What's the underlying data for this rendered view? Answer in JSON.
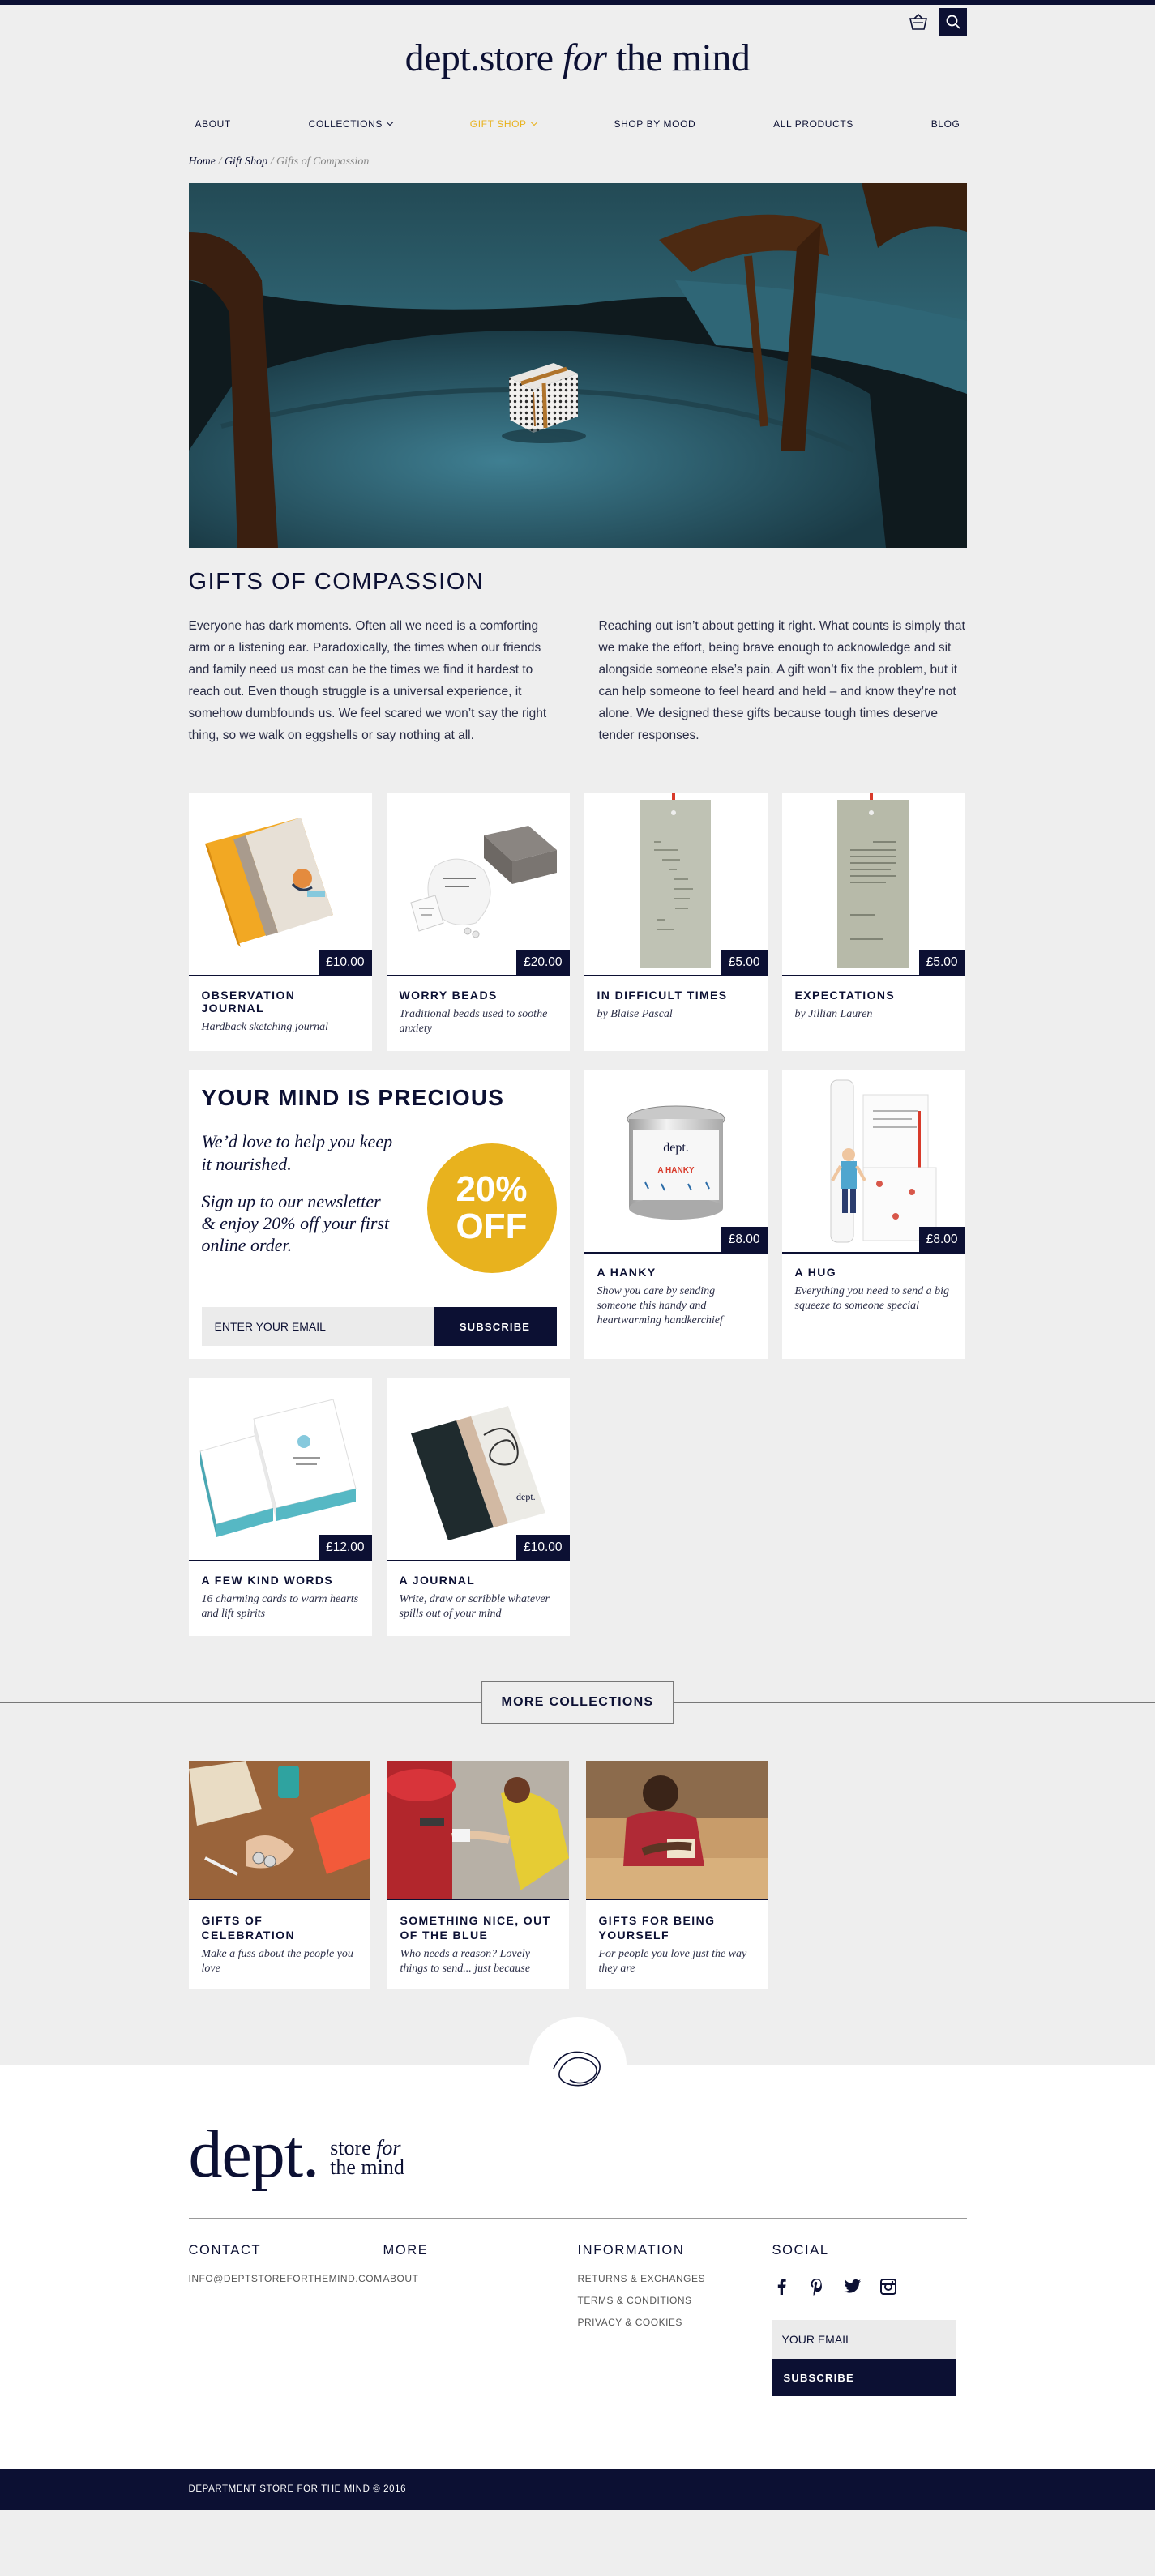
{
  "header": {
    "logo_left": "dept.store ",
    "logo_italic": "for",
    "logo_right": " the mind"
  },
  "nav": {
    "items": [
      "ABOUT",
      "COLLECTIONS",
      "GIFT SHOP",
      "SHOP BY MOOD",
      "ALL PRODUCTS",
      "BLOG"
    ],
    "active": "GIFT SHOP"
  },
  "breadcrumb": {
    "home": "Home",
    "shop": "Gift Shop",
    "current": "Gifts of Compassion",
    "separator": "/"
  },
  "page": {
    "title": "GIFTS OF COMPASSION",
    "intro_left": "Everyone has dark moments. Often all we need is a comforting arm or a listening ear. Paradoxically, the times when our friends and family need us most can be the times we find it hardest to reach out. Even though struggle is a universal experience, it somehow dumbfounds us. We feel scared we won’t say the right thing, so we walk on eggshells or say nothing at all.",
    "intro_right": "Reaching out isn’t about getting it right. What counts is simply that we make the effort, being brave enough to acknowledge and sit alongside someone else’s pain. A gift won’t fix the problem, but it can help someone to feel heard and held – and know they’re not alone. We designed these gifts because tough times deserve tender responses."
  },
  "products": [
    {
      "name": "OBSERVATION JOURNAL",
      "desc": "Hardback sketching journal",
      "price": "£10.00"
    },
    {
      "name": "WORRY BEADS",
      "desc": "Traditional beads used to soothe anxiety",
      "price": "£20.00"
    },
    {
      "name": "IN DIFFICULT TIMES",
      "desc": "by Blaise Pascal",
      "price": "£5.00"
    },
    {
      "name": "EXPECTATIONS",
      "desc": "by Jillian Lauren",
      "price": "£5.00"
    },
    {
      "name": "A HANKY",
      "desc": "Show you care by sending someone this handy and heartwarming handkerchief",
      "price": "£8.00",
      "tin_brand": "dept.",
      "tin_label": "A HANKY"
    },
    {
      "name": "A HUG",
      "desc": "Everything you need to send a big squeeze to someone special",
      "price": "£8.00"
    },
    {
      "name": "A FEW KIND WORDS",
      "desc": "16 charming cards to warm hearts and lift spirits",
      "price": "£12.00"
    },
    {
      "name": "A JOURNAL",
      "desc": "Write, draw or scribble whatever spills out of your mind",
      "price": "£10.00"
    }
  ],
  "promo": {
    "title": "YOUR MIND IS PRECIOUS",
    "line1": "We’d love to help you keep it nourished.",
    "line2": "Sign up to our newsletter & enjoy 20% off your first online order.",
    "badge_top": "20%",
    "badge_bottom": "OFF",
    "email_placeholder": "ENTER YOUR EMAIL",
    "subscribe": "SUBSCRIBE"
  },
  "more_collections": {
    "label": "MORE COLLECTIONS",
    "items": [
      {
        "name": "GIFTS OF CELEBRATION",
        "desc": "Make a fuss about the people you love"
      },
      {
        "name": "SOMETHING NICE, OUT OF THE BLUE",
        "desc": "Who needs a reason? Lovely things to send... just because"
      },
      {
        "name": "GIFTS FOR BEING YOURSELF",
        "desc": "For people you love just the way they are"
      }
    ]
  },
  "footer": {
    "logo_big": "dept.",
    "logo_small_1": "store ",
    "logo_small_italic": "for",
    "logo_small_2": "the mind",
    "contact_title": "CONTACT",
    "contact_email": "INFO@DEPTSTOREFORTHEMIND.COM",
    "more_title": "MORE",
    "more_links": [
      "ABOUT"
    ],
    "info_title": "INFORMATION",
    "info_links": [
      "RETURNS & EXCHANGES",
      "TERMS & CONDITIONS",
      "PRIVACY & COOKIES"
    ],
    "social_title": "SOCIAL",
    "social_icons": [
      "facebook-icon",
      "pinterest-icon",
      "twitter-icon",
      "instagram-icon"
    ],
    "email_placeholder": "YOUR EMAIL",
    "subscribe": "SUBSCRIBE",
    "copyright": "DEPARTMENT STORE FOR THE MIND © 2016"
  },
  "colors": {
    "navy": "#0c1033",
    "accent_yellow": "#e8b21e",
    "background": "#eeeeee"
  }
}
